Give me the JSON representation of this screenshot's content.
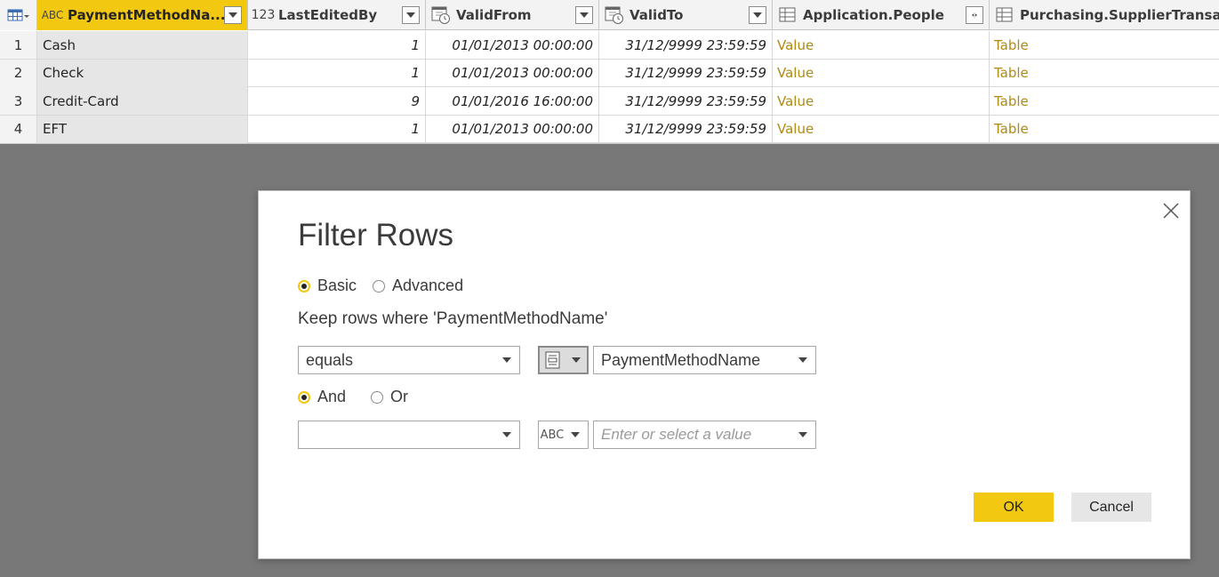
{
  "grid": {
    "columns": [
      {
        "type_icon": "ABC",
        "label": "PaymentMethodNa...",
        "active": true
      },
      {
        "type_icon": "123",
        "label": "LastEditedBy"
      },
      {
        "type_icon": "datetime",
        "label": "ValidFrom"
      },
      {
        "type_icon": "datetime",
        "label": "ValidTo"
      },
      {
        "type_icon": "table",
        "label": "Application.People"
      },
      {
        "type_icon": "table",
        "label": "Purchasing.SupplierTransactions"
      }
    ],
    "rows": [
      {
        "num": "1",
        "name": "Cash",
        "editedby": "1",
        "validfrom": "01/01/2013 00:00:00",
        "validto": "31/12/9999 23:59:59",
        "people": "Value",
        "supplier": "Table"
      },
      {
        "num": "2",
        "name": "Check",
        "editedby": "1",
        "validfrom": "01/01/2013 00:00:00",
        "validto": "31/12/9999 23:59:59",
        "people": "Value",
        "supplier": "Table"
      },
      {
        "num": "3",
        "name": "Credit-Card",
        "editedby": "9",
        "validfrom": "01/01/2016 16:00:00",
        "validto": "31/12/9999 23:59:59",
        "people": "Value",
        "supplier": "Table"
      },
      {
        "num": "4",
        "name": "EFT",
        "editedby": "1",
        "validfrom": "01/01/2013 00:00:00",
        "validto": "31/12/9999 23:59:59",
        "people": "Value",
        "supplier": "Table"
      }
    ]
  },
  "dialog": {
    "title": "Filter Rows",
    "mode_basic": "Basic",
    "mode_advanced": "Advanced",
    "selected_mode": "Basic",
    "keep_text": "Keep rows where 'PaymentMethodName'",
    "condition1": {
      "operator": "equals",
      "value_type_icon": "column",
      "value": "PaymentMethodName"
    },
    "join_and": "And",
    "join_or": "Or",
    "selected_join": "And",
    "condition2": {
      "operator": "",
      "value_type_icon": "ABC",
      "value_placeholder": "Enter or select a value"
    },
    "ok_label": "OK",
    "cancel_label": "Cancel"
  },
  "colors": {
    "accent": "#f2c811",
    "link": "#b08a14",
    "overlay": "#787878"
  }
}
